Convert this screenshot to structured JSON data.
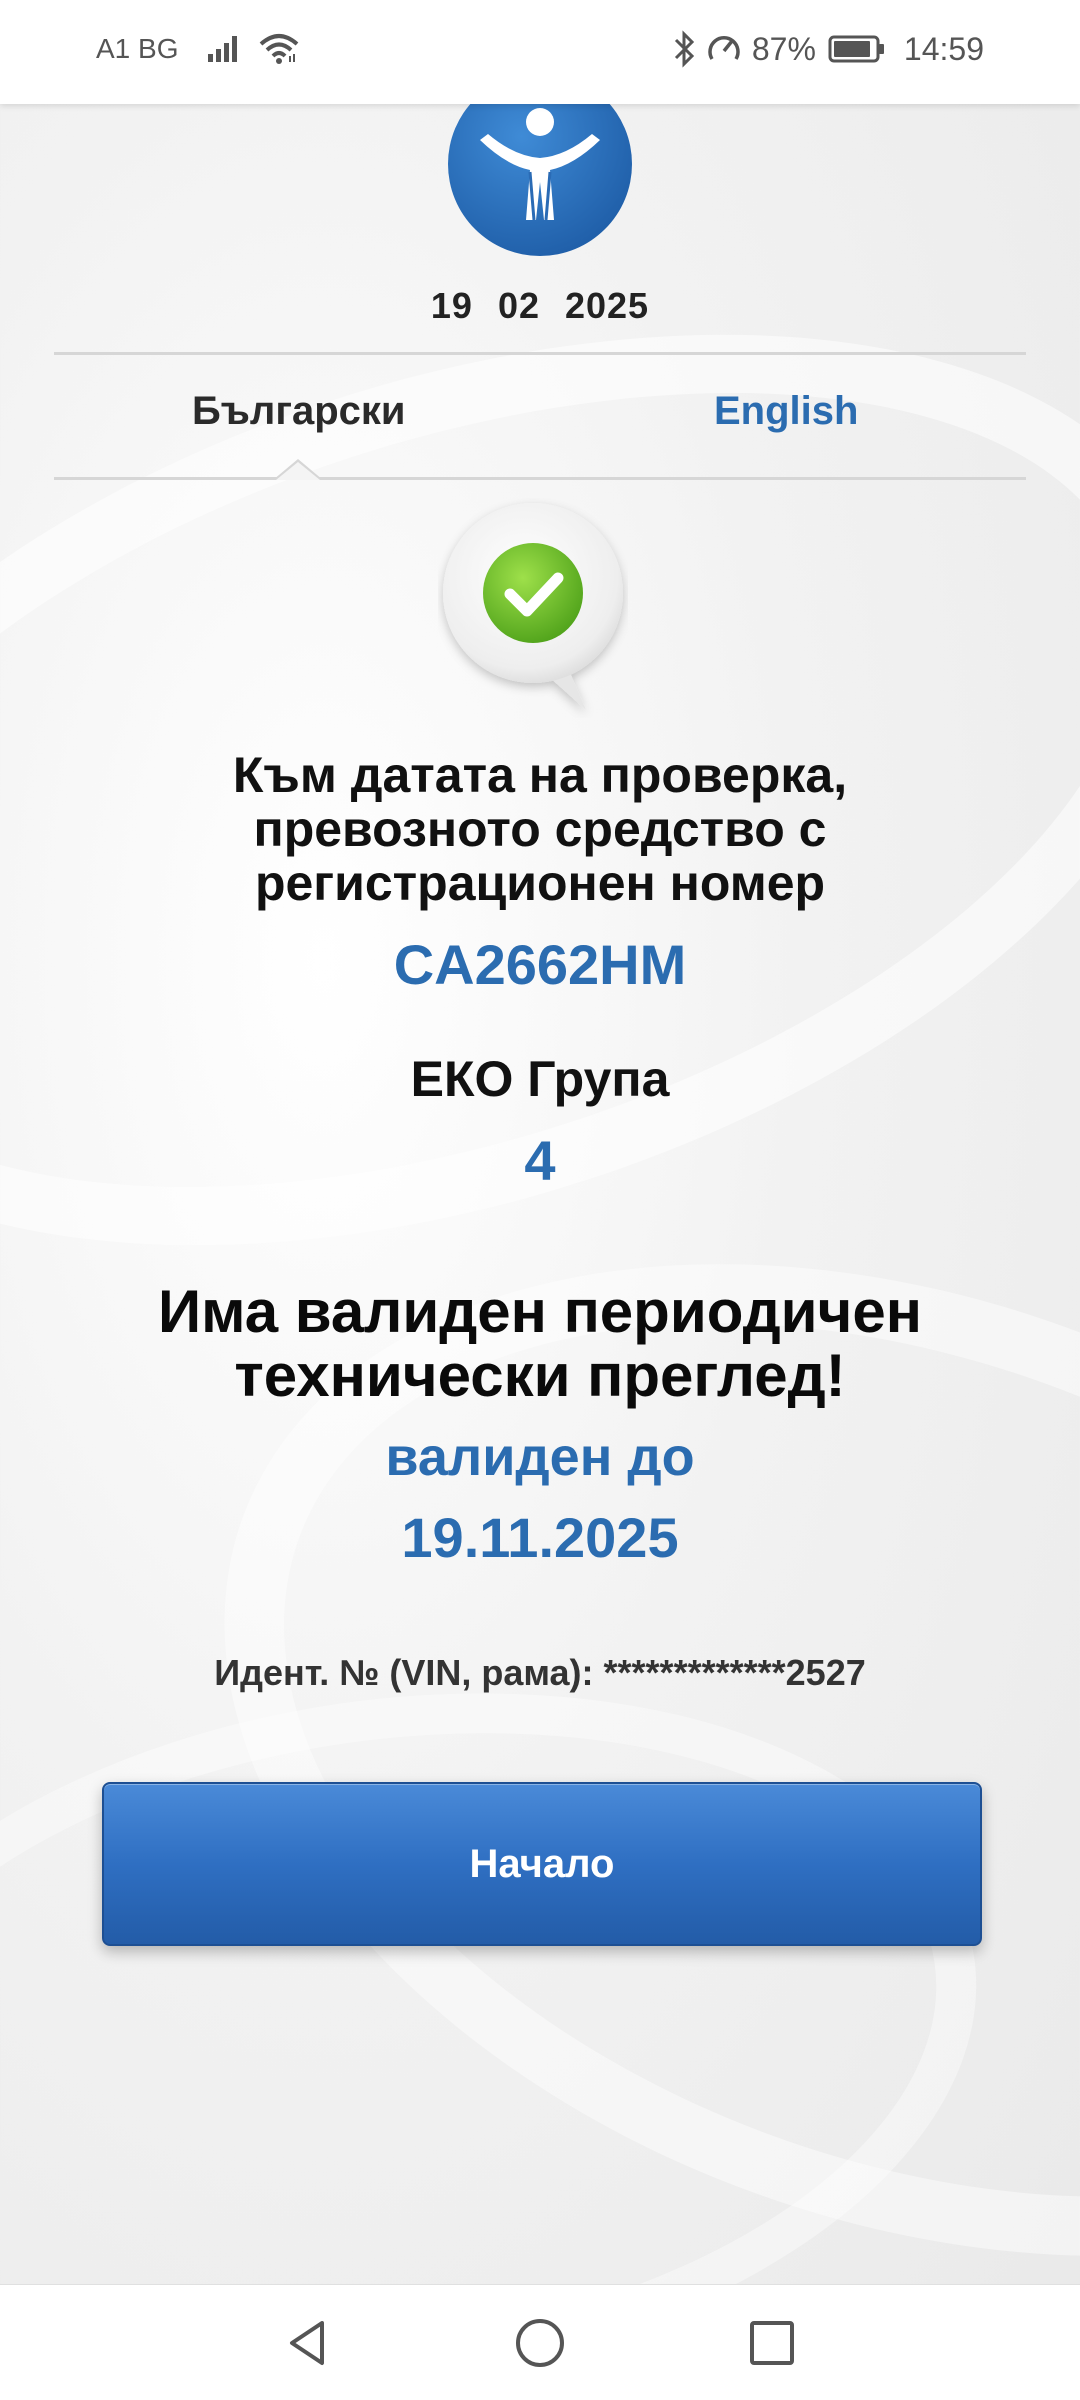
{
  "status_bar": {
    "carrier": "A1 BG",
    "battery_percent": "87%",
    "time": "14:59",
    "icons": [
      "signal-icon",
      "wifi-icon",
      "bluetooth-icon",
      "data-saver-icon",
      "battery-icon"
    ]
  },
  "header": {
    "logo": "inspection-logo",
    "check_date": "19  02  2025"
  },
  "language_tabs": [
    {
      "label": "Български",
      "selected": true
    },
    {
      "label": "English",
      "selected": false
    }
  ],
  "result": {
    "status_icon": "check-icon",
    "intro": "Към датата на проверка, превозното средство с регистрационен номер",
    "registration_number": "CA2662HM",
    "eco_group_label": "ЕКО Група",
    "eco_group_value": "4",
    "inspection_status": "Има валиден периодичен технически преглед!",
    "valid_until_label": "валиден до",
    "valid_until_date": "19.11.2025",
    "vin_line": "Идент. № (VIN, рама): *************2527"
  },
  "start_button": {
    "label": "Начало"
  },
  "nav_bar": {
    "icons": [
      "back-icon",
      "home-icon",
      "recent-apps-icon"
    ]
  },
  "colors": {
    "accent_blue": "#2b6cb0",
    "button_blue": "#2f6fc2",
    "check_green": "#6fbf2a"
  }
}
